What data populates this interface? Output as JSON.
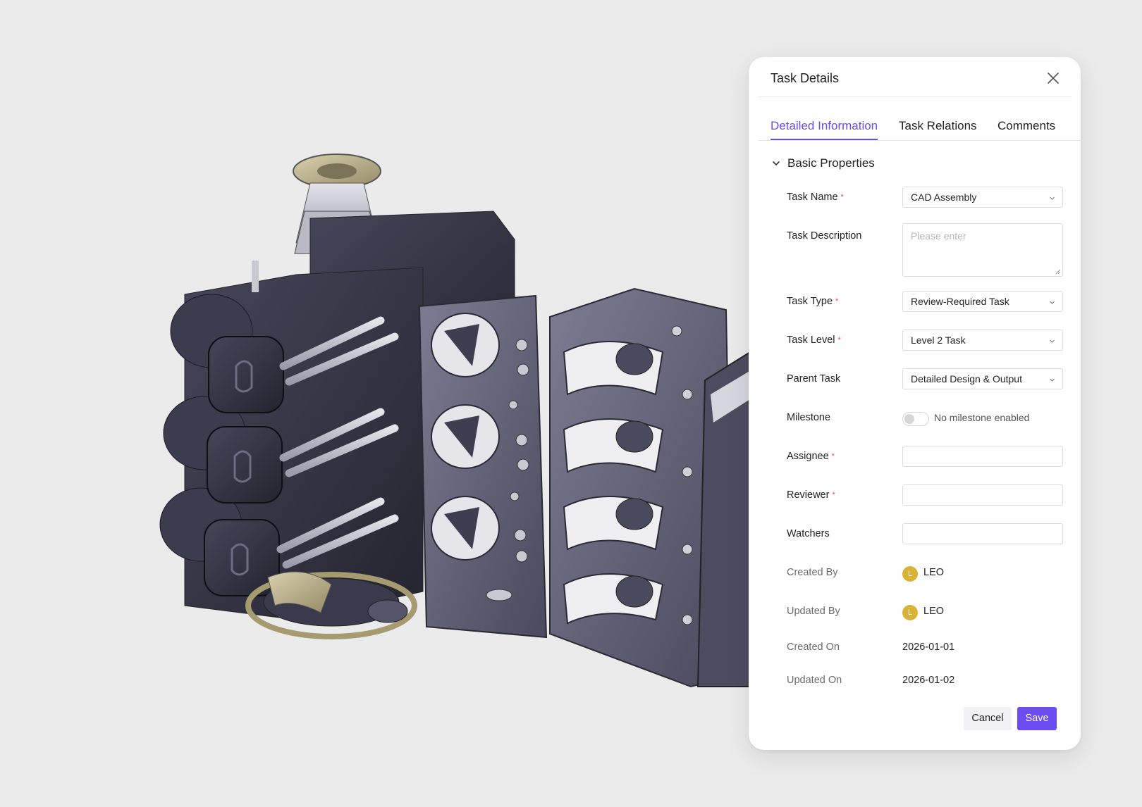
{
  "panel": {
    "title": "Task Details",
    "close_icon": "close-icon",
    "tabs": [
      {
        "label": "Detailed Information",
        "active": true
      },
      {
        "label": "Task Relations",
        "active": false
      },
      {
        "label": "Comments",
        "active": false
      }
    ],
    "section": {
      "title": "Basic Properties",
      "expanded": true
    },
    "fields": {
      "task_name": {
        "label": "Task Name",
        "required": true,
        "value": "CAD Assembly"
      },
      "task_description": {
        "label": "Task Description",
        "placeholder": "Please enter"
      },
      "task_type": {
        "label": "Task Type",
        "required": true,
        "value": "Review-Required Task"
      },
      "task_level": {
        "label": "Task Level",
        "required": true,
        "value": "Level 2 Task"
      },
      "parent_task": {
        "label": "Parent Task",
        "value": "Detailed Design & Output"
      },
      "milestone": {
        "label": "Milestone",
        "enabled": false,
        "text": "No milestone enabled"
      },
      "assignee": {
        "label": "Assignee",
        "required": true,
        "value": ""
      },
      "reviewer": {
        "label": "Reviewer",
        "required": true,
        "value": ""
      },
      "watchers": {
        "label": "Watchers",
        "value": ""
      },
      "created_by": {
        "label": "Created By",
        "initial": "L",
        "name": "LEO"
      },
      "updated_by": {
        "label": "Updated By",
        "initial": "L",
        "name": "LEO"
      },
      "created_on": {
        "label": "Created On",
        "value": "2026-01-01"
      },
      "updated_on": {
        "label": "Updated On",
        "value": "2026-01-02"
      }
    },
    "required_mark": "*",
    "buttons": {
      "cancel": "Cancel",
      "save": "Save"
    }
  },
  "colors": {
    "accent": "#6a4cf0",
    "required": "#e5484d",
    "avatar": "#d8b336",
    "background": "#ebebeb",
    "model_metal": "#5b5b72"
  }
}
